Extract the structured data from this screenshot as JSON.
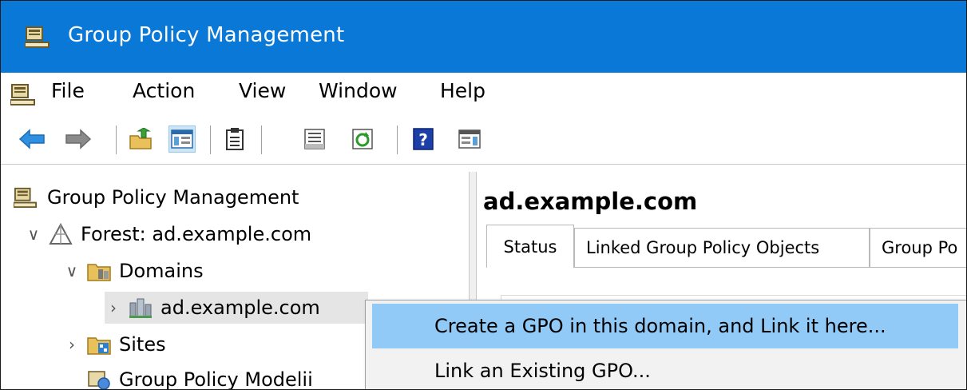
{
  "window": {
    "title": "Group Policy Management",
    "icon": "gpmc-icon"
  },
  "menu": [
    "File",
    "Action",
    "View",
    "Window",
    "Help"
  ],
  "toolbar": {
    "buttons": [
      "back-arrow-icon",
      "forward-arrow-icon",
      "folder-up-icon",
      "show-hide-tree-icon",
      "clipboard-icon",
      "properties-icon",
      "refresh-icon",
      "help-icon",
      "action-pane-icon"
    ]
  },
  "tree": {
    "items": [
      {
        "label": "Group Policy Management",
        "icon": "gpmc-icon",
        "chevron": ""
      },
      {
        "label": "Forest: ad.example.com",
        "icon": "forest-icon",
        "chevron": "∨"
      },
      {
        "label": "Domains",
        "icon": "domains-folder-icon",
        "chevron": "∨"
      },
      {
        "label": "ad.example.com",
        "icon": "domain-icon",
        "chevron": "›"
      },
      {
        "label": "Sites",
        "icon": "sites-folder-icon",
        "chevron": "›"
      },
      {
        "label": "Group Policy Modelii",
        "icon": "modeling-icon",
        "chevron": ""
      }
    ]
  },
  "details": {
    "title": "ad.example.com",
    "tabs": [
      "Status",
      "Linked Group Policy Objects",
      "Group Po"
    ]
  },
  "context_menu": {
    "items": [
      "Create a GPO in this domain, and Link it here...",
      "Link an Existing GPO..."
    ]
  }
}
